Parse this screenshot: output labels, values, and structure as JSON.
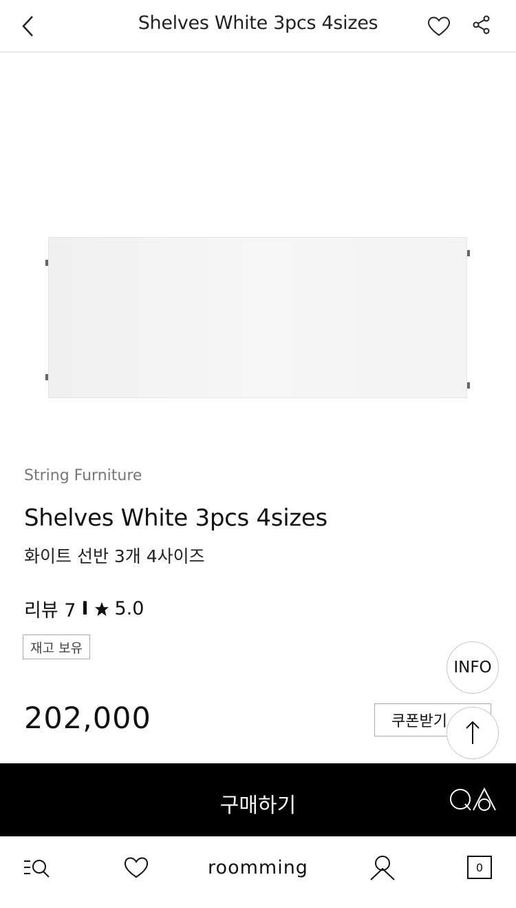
{
  "header": {
    "title": "Shelves White 3pcs 4sizes",
    "back_icon": "chevron-left-icon",
    "wishlist_icon": "heart-icon",
    "share_icon": "share-icon"
  },
  "product": {
    "brand": "String Furniture",
    "name_en": "Shelves White 3pcs 4sizes",
    "name_ko": "화이트 선반 3개 4사이즈",
    "review_label": "리뷰 7",
    "review_separator": "I",
    "rating": "5.0",
    "stock_badge": "재고 보유",
    "price": "202,000",
    "coupon_label": "쿠폰받기"
  },
  "floating": {
    "info_label": "INFO",
    "scroll_top_icon": "arrow-up-icon"
  },
  "buy_bar": {
    "buy_label": "구매하기",
    "qa_label": "QA"
  },
  "bottom_nav": {
    "search_icon": "menu-search-icon",
    "wishlist_icon": "heart-icon",
    "logo_text": "roomming",
    "user_icon": "user-icon",
    "cart_count": "0"
  },
  "colors": {
    "background": "#ffffff",
    "buy_bar": "#000000",
    "border": "#aaaaaa"
  }
}
